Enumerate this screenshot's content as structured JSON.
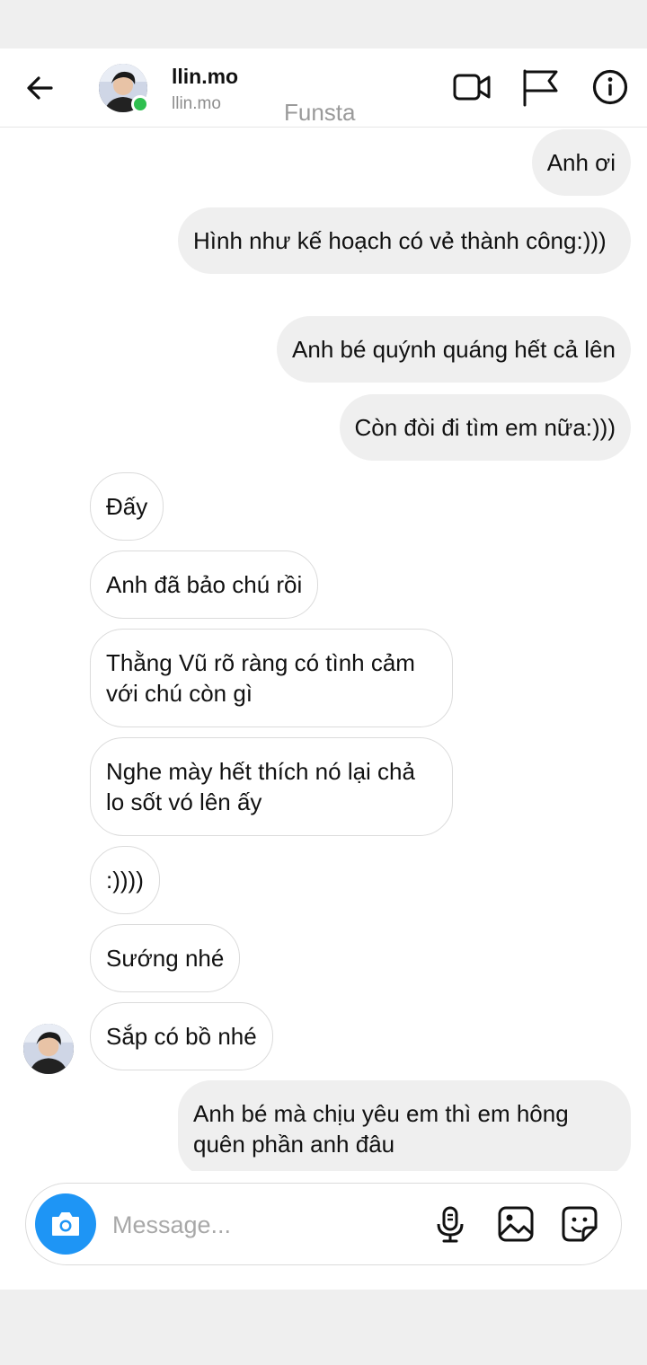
{
  "header": {
    "name": "llin.mo",
    "username": "llin.mo",
    "watermark": "Funsta",
    "icons": [
      "back-arrow-icon",
      "video-camera-icon",
      "flag-icon",
      "info-icon"
    ]
  },
  "messages": [
    {
      "side": "sent",
      "text": "Anh ơi"
    },
    {
      "side": "sent",
      "text": "Hình như kế hoạch có vẻ thành công:)))"
    },
    {
      "side": "sent",
      "text": "Anh bé quýnh quáng hết cả lên"
    },
    {
      "side": "sent",
      "text": "Còn đòi đi tìm em nữa:)))"
    },
    {
      "side": "received",
      "text": "Đấy"
    },
    {
      "side": "received",
      "text": "Anh đã bảo chú rồi"
    },
    {
      "side": "received",
      "text": "Thằng Vũ rõ ràng có tình cảm với chú còn gì"
    },
    {
      "side": "received",
      "text": "Nghe mày hết thích nó lại chả lo sốt vó lên ấy"
    },
    {
      "side": "received",
      "text": ":))))"
    },
    {
      "side": "received",
      "text": "Sướng nhé"
    },
    {
      "side": "received",
      "text": "Sắp có bồ nhé"
    },
    {
      "side": "sent",
      "text": "Anh bé mà chịu yêu em thì em hông quên phần anh đâu"
    }
  ],
  "composer": {
    "placeholder": "Message...",
    "icons": [
      "camera-icon",
      "microphone-icon",
      "gallery-icon",
      "sticker-icon"
    ]
  },
  "colors": {
    "sent_bubble": "#efefef",
    "received_border": "#dbdbdb",
    "camera_button": "#1e95f5",
    "online_dot": "#2fbf4f"
  }
}
